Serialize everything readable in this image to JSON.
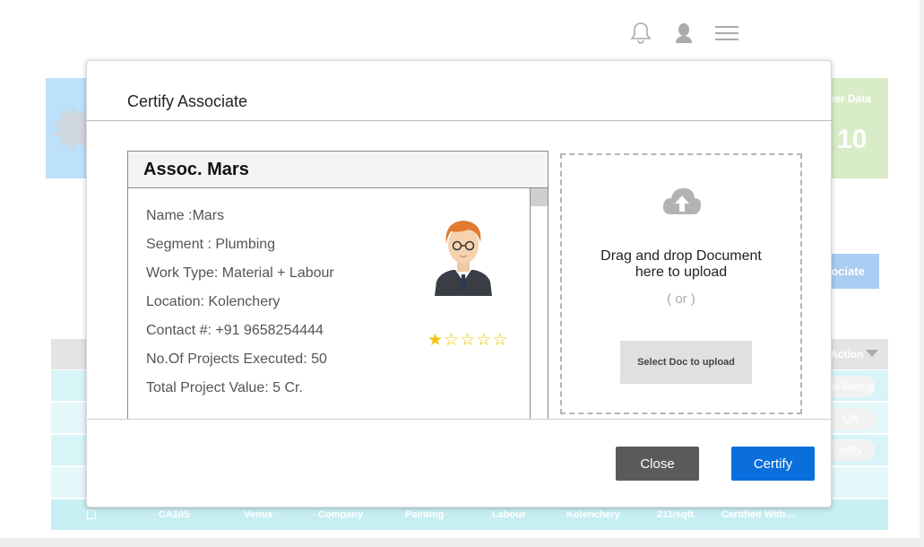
{
  "topbar": {
    "icons": [
      "bell-icon",
      "user-icon",
      "hamburger-menu-icon"
    ]
  },
  "background": {
    "stat_card_right": {
      "title": "her Data",
      "value": "10"
    },
    "associate_button": "sociate",
    "table": {
      "action_header": "Action",
      "row_actions": [
        "dd Rating",
        "QA",
        "ertify"
      ],
      "last_row": [
        "CA105",
        "Venus",
        "Company",
        "Painting",
        "Labour",
        "Kolenchery",
        "211/sqft",
        "Certified With…"
      ]
    }
  },
  "modal": {
    "title": "Certify Associate",
    "associate": {
      "name_header": "Assoc. Mars",
      "details": [
        "Name :Mars",
        "Segment : Plumbing",
        "Work Type: Material + Labour",
        "Location: Kolenchery",
        "Contact #: +91 9658254444",
        "No.Of Projects Executed: 50",
        "Total Project Value: 5 Cr."
      ],
      "rating": 1,
      "rating_max": 5,
      "star_filled": "★",
      "star_empty": "☆"
    },
    "upload": {
      "drop_text_line1": "Drag and drop Document",
      "drop_text_line2": "here to upload",
      "or_text": "( or )",
      "select_button": "Select Doc to upload"
    },
    "footer": {
      "close_label": "Close",
      "certify_label": "Certify"
    }
  },
  "colors": {
    "certify_blue": "#0a6fdc",
    "close_gray": "#5a5a5a",
    "star_gold": "#f2c311"
  }
}
